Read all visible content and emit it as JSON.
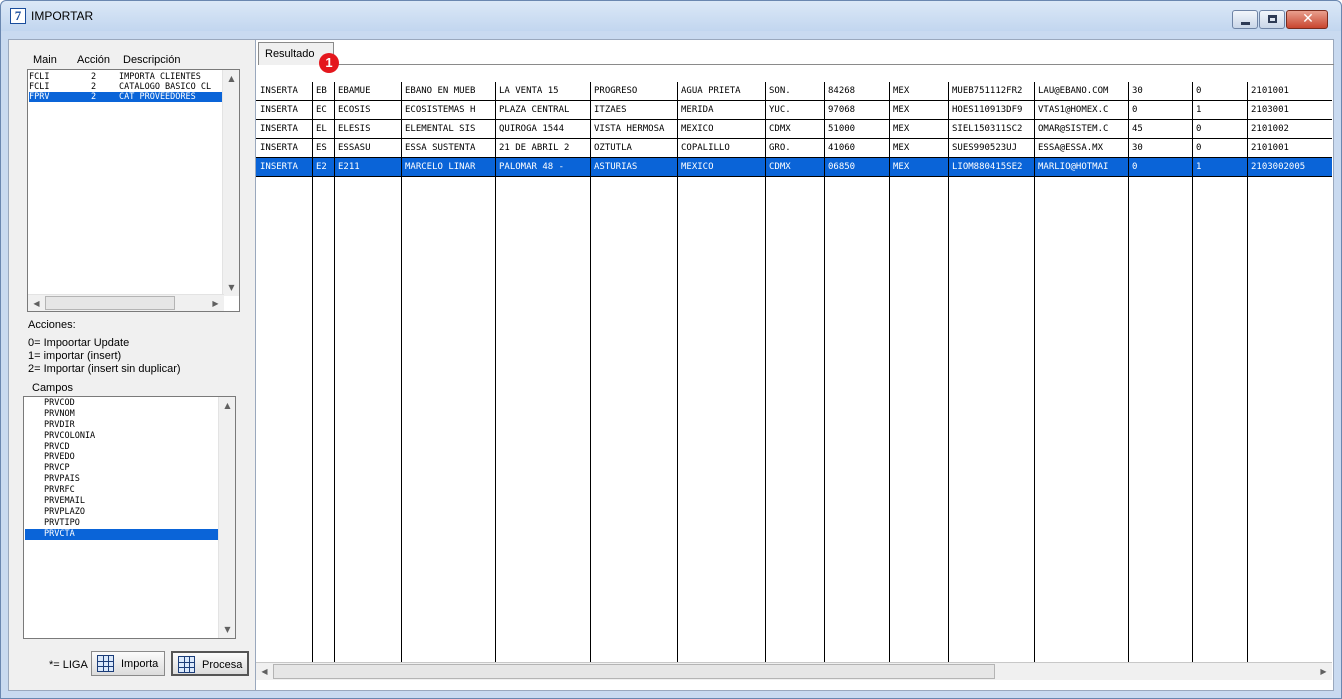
{
  "window": {
    "title": "IMPORTAR",
    "icon": "7"
  },
  "left": {
    "header": {
      "main": "Main",
      "accion": "Acción",
      "descripcion": "Descripción"
    },
    "main_list": [
      {
        "main": "FCLI",
        "accion": "2",
        "descripcion": "IMPORTA CLIENTES",
        "selected": false
      },
      {
        "main": "FCLI",
        "accion": "2",
        "descripcion": "CATALOGO BASICO CL",
        "selected": false
      },
      {
        "main": "FPRV",
        "accion": "2",
        "descripcion": "CAT PROVEEDORES",
        "selected": true
      }
    ],
    "acciones_label": "Acciones:",
    "acciones": [
      "0= Impoortar Update",
      "1= importar (insert)",
      "2= Importar (insert sin duplicar)"
    ],
    "campos_label": "Campos",
    "campos": [
      "PRVCOD",
      "PRVNOM",
      "PRVDIR",
      "PRVCOLONIA",
      "PRVCD",
      "PRVEDO",
      "PRVCP",
      "PRVPAIS",
      "PRVRFC",
      "PRVEMAIL",
      "PRVPLAZO",
      "PRVTIPO",
      "PRVCTA"
    ],
    "campos_selected": 12,
    "liga_label": "*= LIGA",
    "importa_label": "Importa",
    "procesa_label": "Procesa"
  },
  "right": {
    "tab_label": "Resultado",
    "badge": "1",
    "rows": [
      {
        "selected": false,
        "cells": [
          "INSERTA",
          "EB",
          "EBAMUE",
          "EBANO EN MUEB",
          "LA VENTA 15",
          "PROGRESO",
          "AGUA PRIETA",
          "SON.",
          "84268",
          "MEX",
          "MUEB751112FR2",
          "LAU@EBANO.COM",
          "30",
          "0",
          "2101001"
        ]
      },
      {
        "selected": false,
        "cells": [
          "INSERTA",
          "EC",
          "ECOSIS",
          "ECOSISTEMAS H",
          "PLAZA CENTRAL",
          "ITZAES",
          "MERIDA",
          "YUC.",
          "97068",
          "MEX",
          "HOES110913DF9",
          "VTAS1@HOMEX.C",
          "0",
          "1",
          "2103001"
        ]
      },
      {
        "selected": false,
        "cells": [
          "INSERTA",
          "EL",
          "ELESIS",
          "ELEMENTAL SIS",
          "QUIROGA 1544",
          "VISTA HERMOSA",
          "MEXICO",
          "CDMX",
          "51000",
          "MEX",
          "SIEL150311SC2",
          "OMAR@SISTEM.C",
          "45",
          "0",
          "2101002"
        ]
      },
      {
        "selected": false,
        "cells": [
          "INSERTA",
          "ES",
          "ESSASU",
          "ESSA SUSTENTA",
          "21 DE ABRIL 2",
          "OZTUTLA",
          "COPALILLO",
          "GRO.",
          "41060",
          "MEX",
          "SUES990523UJ",
          "ESSA@ESSA.MX",
          "30",
          "0",
          "2101001"
        ]
      },
      {
        "selected": true,
        "cells": [
          "INSERTA",
          "E2",
          "E211",
          "MARCELO LINAR",
          "PALOMAR 48 -",
          "ASTURIAS",
          "MEXICO",
          "CDMX",
          "06850",
          "MEX",
          "LIOM880415SE2",
          "MARLIO@HOTMAI",
          "0",
          "1",
          "2103002005"
        ]
      }
    ]
  },
  "colors": {
    "selection": "#0a64d8",
    "badge": "#e4171d",
    "titlebar": "#c9daf0"
  }
}
